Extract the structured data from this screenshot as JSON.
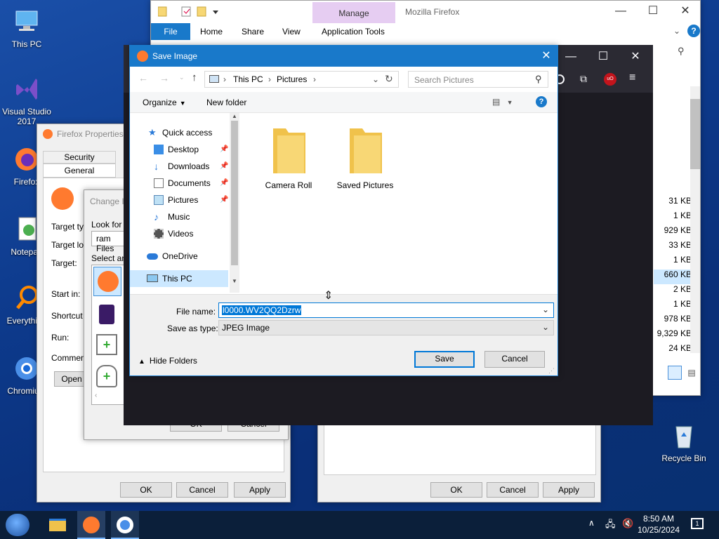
{
  "desktop": {
    "icons": [
      {
        "label": "This PC"
      },
      {
        "label": "Visual Studio 2017"
      },
      {
        "label": "Firefox"
      },
      {
        "label": "Notepad"
      },
      {
        "label": "Everything"
      },
      {
        "label": "Chromium"
      },
      {
        "label": "Recycle Bin"
      }
    ]
  },
  "explorer": {
    "title": "Mozilla Firefox",
    "context_tab": "Manage",
    "tabs": [
      "File",
      "Home",
      "Share",
      "View",
      "Application Tools"
    ],
    "sizes": [
      "31 KB",
      "1 KB",
      "929 KB",
      "33 KB",
      "1 KB",
      "660 KB",
      "2 KB",
      "1 KB",
      "978 KB",
      "9,329 KB",
      "24 KB"
    ]
  },
  "properties": {
    "title": "Firefox Properties",
    "tabs": [
      "Security",
      "General"
    ],
    "fields": [
      "Target typ",
      "Target loc",
      "Target:",
      "Start in:",
      "Shortcut k",
      "Run:",
      "Comment:"
    ],
    "open_button": "Open",
    "buttons": {
      "ok": "OK",
      "cancel": "Cancel",
      "apply": "Apply"
    }
  },
  "change_icon": {
    "title": "Change I",
    "look_for": "Look for ic",
    "path_value": "ram Files",
    "select_label": "Select an",
    "ok": "OK",
    "cancel": "Cancel"
  },
  "right_props": {
    "buttons": {
      "ok": "OK",
      "cancel": "Cancel",
      "apply": "Apply"
    }
  },
  "save_dialog": {
    "title": "Save Image",
    "breadcrumb": [
      "This PC",
      "Pictures"
    ],
    "search_placeholder": "Search Pictures",
    "organize": "Organize",
    "new_folder": "New folder",
    "nav": {
      "quick_access": "Quick access",
      "items": [
        {
          "label": "Desktop",
          "icon": "desktop-icon",
          "pinned": true
        },
        {
          "label": "Downloads",
          "icon": "downloads-icon",
          "pinned": true
        },
        {
          "label": "Documents",
          "icon": "documents-icon",
          "pinned": true
        },
        {
          "label": "Pictures",
          "icon": "pictures-icon",
          "pinned": true
        },
        {
          "label": "Music",
          "icon": "music-icon",
          "pinned": false
        },
        {
          "label": "Videos",
          "icon": "videos-icon",
          "pinned": false
        }
      ],
      "onedrive": "OneDrive",
      "this_pc": "This PC"
    },
    "folders": [
      "Camera Roll",
      "Saved Pictures"
    ],
    "file_name_label": "File name:",
    "file_name_value": "l0000.WV2QQ2Dzrw",
    "save_type_label": "Save as type:",
    "save_type_value": "JPEG Image",
    "hide_folders": "Hide Folders",
    "save": "Save",
    "cancel": "Cancel"
  },
  "taskbar": {
    "time": "8:50 AM",
    "date": "10/25/2024"
  }
}
